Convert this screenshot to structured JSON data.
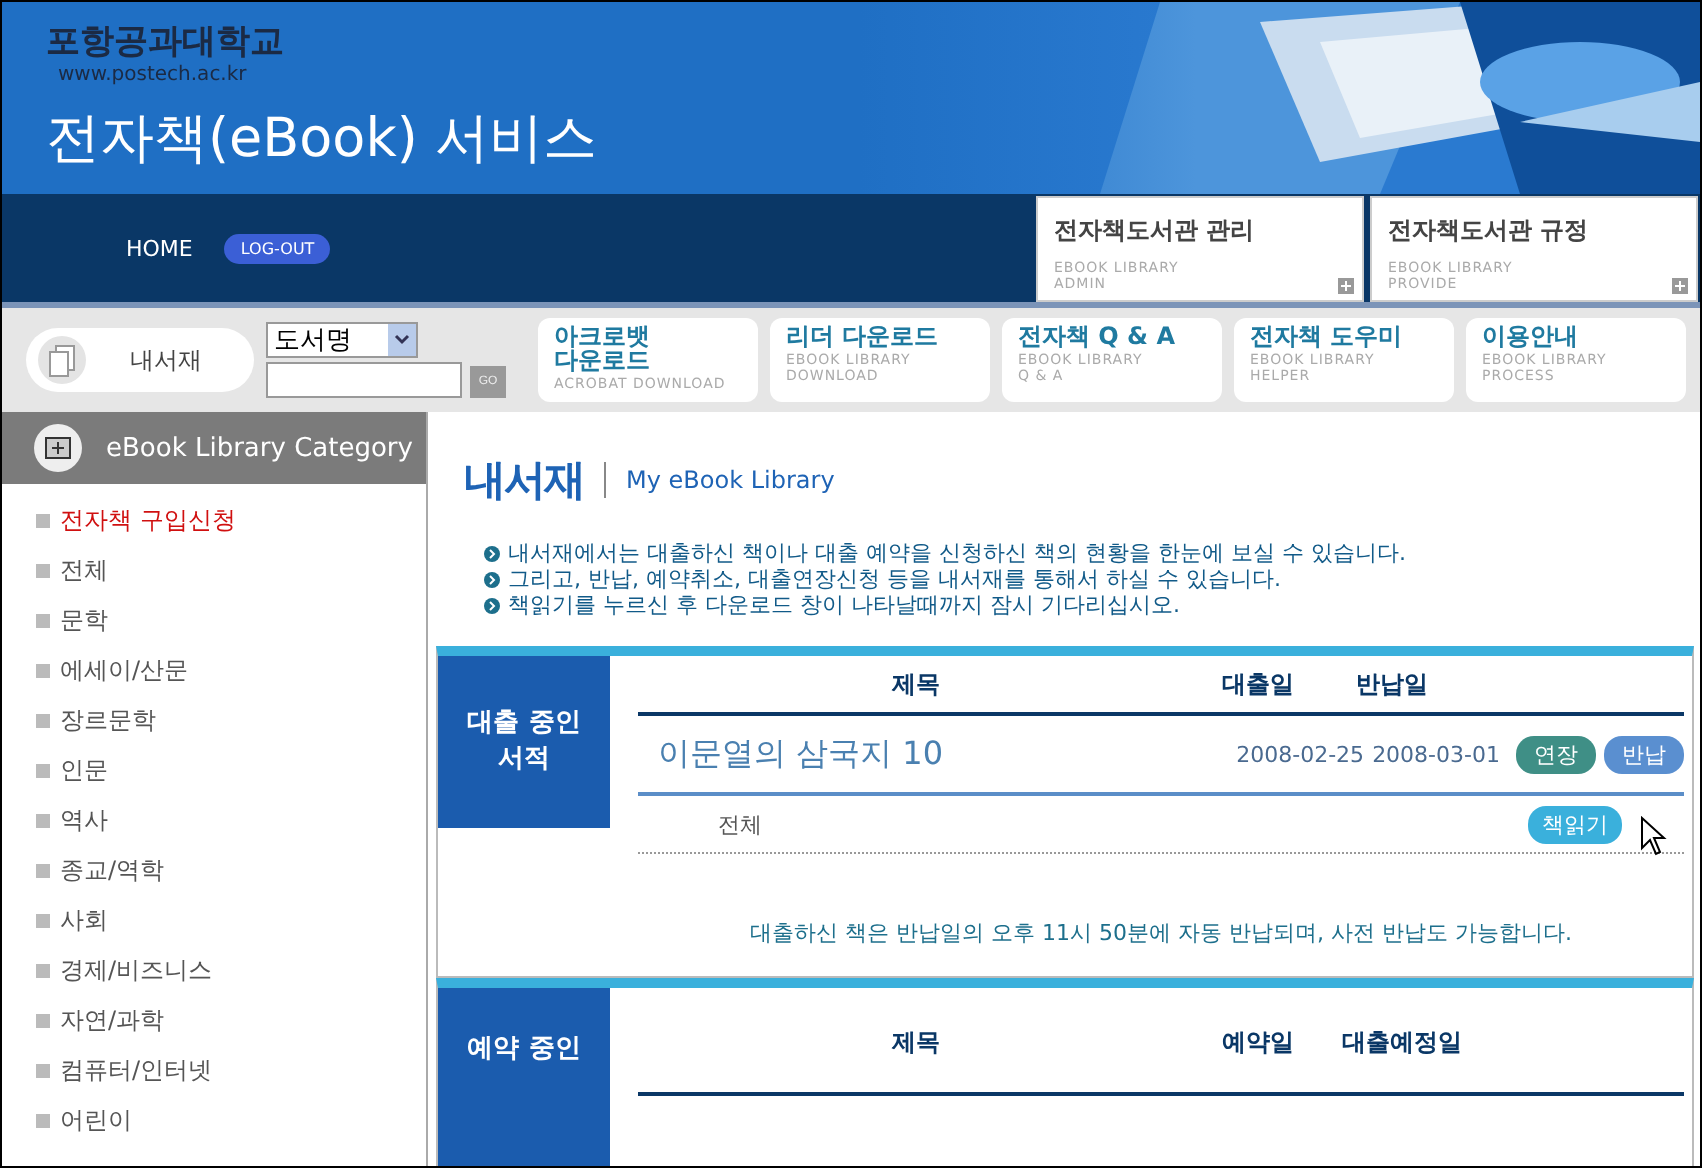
{
  "header": {
    "university": "포항공과대학교",
    "url": "www.postech.ac.kr",
    "title": "전자책(eBook) 서비스"
  },
  "nav": {
    "links": [
      {
        "label": "HOME",
        "kind": "text"
      },
      {
        "label": "LOG-OUT",
        "kind": "pill"
      }
    ],
    "panels": [
      {
        "title": "전자책도서관 관리",
        "subtitle": [
          "EBOOK LIBRARY",
          "ADMIN"
        ]
      },
      {
        "title": "전자책도서관 규정",
        "subtitle": [
          "EBOOK LIBRARY",
          "PROVIDE"
        ]
      }
    ]
  },
  "toolbar": {
    "shelf": "내서재",
    "search_type": "도서명",
    "go": "GO",
    "menu": [
      {
        "title": [
          "아크로뱃",
          "다운로드"
        ],
        "subtitle": [
          "ACROBAT DOWNLOAD"
        ]
      },
      {
        "title": [
          "리더 다운로드"
        ],
        "subtitle": [
          "EBOOK LIBRARY",
          "DOWNLOAD"
        ]
      },
      {
        "title": [
          "전자책 Q & A"
        ],
        "subtitle": [
          "EBOOK LIBRARY",
          "Q & A"
        ]
      },
      {
        "title": [
          "전자책 도우미"
        ],
        "subtitle": [
          "EBOOK LIBRARY",
          "HELPER"
        ]
      },
      {
        "title": [
          "이용안내"
        ],
        "subtitle": [
          "EBOOK LIBRARY",
          "PROCESS"
        ]
      }
    ]
  },
  "sidebar": {
    "heading": "eBook Library Category",
    "items": [
      {
        "label": "전자책 구입신청",
        "selected": true
      },
      {
        "label": "전체",
        "selected": false
      },
      {
        "label": "문학",
        "selected": false
      },
      {
        "label": "에세이/산문",
        "selected": false
      },
      {
        "label": "장르문학",
        "selected": false
      },
      {
        "label": "인문",
        "selected": false
      },
      {
        "label": "역사",
        "selected": false
      },
      {
        "label": "종교/역학",
        "selected": false
      },
      {
        "label": "사회",
        "selected": false
      },
      {
        "label": "경제/비즈니스",
        "selected": false
      },
      {
        "label": "자연/과학",
        "selected": false
      },
      {
        "label": "컴퓨터/인터넷",
        "selected": false
      },
      {
        "label": "어린이",
        "selected": false
      }
    ]
  },
  "main": {
    "title": "내서재",
    "subtitle": "My eBook Library",
    "notices": [
      "내서재에서는 대출하신 책이나 대출 예약을 신청하신 책의 현황을 한눈에 보실 수 있습니다.",
      "그리고, 반납, 예약취소, 대출연장신청 등을 내서재를 통해서 하실 수 있습니다.",
      "책읽기를 누르신 후 다운로드 창이 나타날때까지 잠시 기다리십시오."
    ],
    "loans": {
      "label": [
        "대출 중인",
        "서적"
      ],
      "columns": [
        "제목",
        "대출일",
        "반납일"
      ],
      "rows": [
        {
          "title": "이문열의 삼국지 10",
          "date_1": "2008-02-25",
          "date_2": "2008-03-01",
          "actions": [
            {
              "label": "연장",
              "kind": "extend"
            },
            {
              "label": "반납",
              "kind": "return"
            }
          ],
          "category": "전체",
          "read": "책읽기"
        }
      ],
      "note": "대출하신 책은 반납일의 오후 11시 50분에 자동 반납되며, 사전 반납도 가능합니다."
    },
    "reservations": {
      "label": [
        "예약 중인"
      ],
      "columns": [
        "제목",
        "예약일",
        "대출예정일"
      ]
    }
  }
}
